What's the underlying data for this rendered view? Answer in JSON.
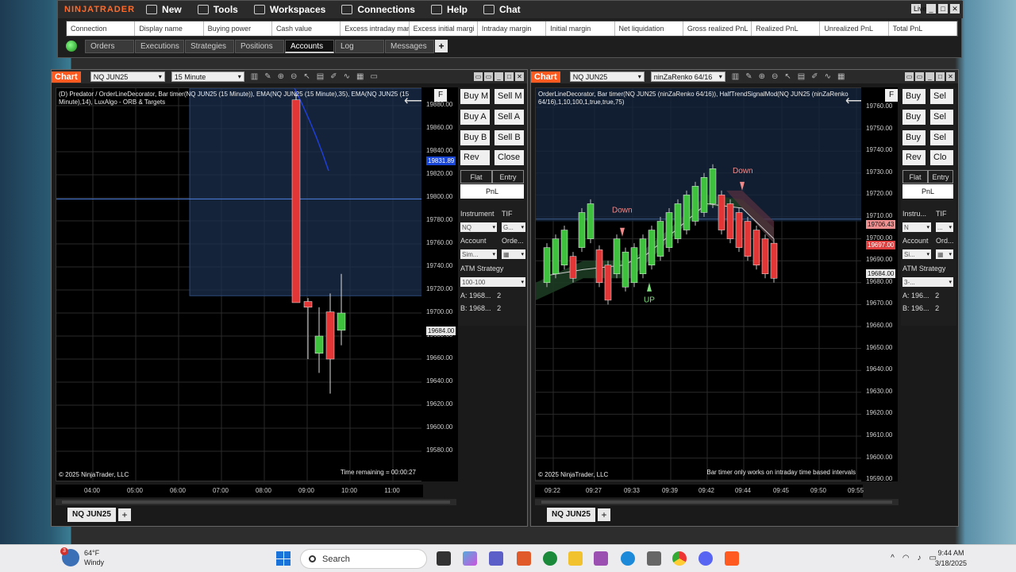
{
  "control_center": {
    "logo": "NINJATRADER",
    "menu": [
      {
        "label": "New",
        "icon": "new-icon"
      },
      {
        "label": "Tools",
        "icon": "tools-icon"
      },
      {
        "label": "Workspaces",
        "icon": "workspaces-icon"
      },
      {
        "label": "Connections",
        "icon": "connections-icon"
      },
      {
        "label": "Help",
        "icon": "help-icon"
      },
      {
        "label": "Chat",
        "icon": "chat-icon"
      }
    ],
    "live_badge": "Live",
    "account_columns": [
      "Connection",
      "Display name",
      "Buying power",
      "Cash value",
      "Excess intraday mar",
      "Excess initial margi",
      "Intraday margin",
      "Initial margin",
      "Net liquidation",
      "Gross realized PnL",
      "Realized PnL",
      "Unrealized PnL",
      "Total PnL"
    ],
    "tabs": [
      "Orders",
      "Executions",
      "Strategies",
      "Positions",
      "Accounts",
      "Log",
      "Messages"
    ],
    "active_tab": "Accounts",
    "colors": {
      "accent": "#ff6a2a",
      "status_green": "#1a8a1a"
    }
  },
  "chart_left": {
    "tag": "Chart",
    "instrument": "NQ JUN25",
    "interval": "15 Minute",
    "description_1": "(D) Predator / OrderLineDecorator, Bar timer(NQ JUN25 (15 Minute)), EMA(NQ JUN25 (15 Minute),35), EMA(NQ JUN25 (15",
    "description_2": "Minute),14), LuxAlgo - ORB & Targets",
    "copyright": "© 2025 NinjaTrader, LLC",
    "time_remaining": "Time remaining = 00:00:27",
    "y_ticks": [
      "19880.00",
      "19860.00",
      "19840.00",
      "19820.00",
      "19800.00",
      "19780.00",
      "19760.00",
      "19740.00",
      "19720.00",
      "19700.00",
      "19680.00",
      "19660.00",
      "19640.00",
      "19620.00",
      "19600.00",
      "19580.00"
    ],
    "price_tags": [
      {
        "label": "19831.89",
        "color": "#1846d8"
      },
      {
        "label": "19684.00",
        "color": "#e8e8e8"
      }
    ],
    "x_ticks": [
      "04:00",
      "05:00",
      "06:00",
      "07:00",
      "08:00",
      "09:00",
      "10:00",
      "11:00"
    ],
    "bottom_tab": "NQ JUN25",
    "chart_trader": {
      "buy_labels": [
        "Buy M",
        "Buy A",
        "Buy B"
      ],
      "sell_labels": [
        "Sell M",
        "Sell A",
        "Sell B"
      ],
      "rev": "Rev",
      "close": "Close",
      "flat": "Flat",
      "entry": "Entry",
      "pnl": "PnL",
      "instrument_label": "Instrument",
      "tif_label": "TIF",
      "instrument_value": "NQ",
      "tif_value": "G...",
      "account_label": "Account",
      "order_label": "Orde...",
      "account_value": "Sim...",
      "atm_label": "ATM Strategy",
      "atm_value": "100-100",
      "a_label": "A:",
      "a_value": "1968...",
      "a_qty": "2",
      "b_label": "B:",
      "b_value": "1968...",
      "b_qty": "2",
      "f_btn": "F"
    }
  },
  "chart_right": {
    "tag": "Chart",
    "instrument": "NQ JUN25",
    "interval": "ninZaRenko 64/16",
    "description_1": "OrderLineDecorator, Bar timer(NQ JUN25 (ninZaRenko 64/16)), HalfTrendSignalMod(NQ JUN25 (ninZaRenko",
    "description_2": "64/16),1,10,100,1,true,true,75)",
    "copyright": "© 2025 NinjaTrader, LLC",
    "bar_timer_note": "Bar timer only works on intraday time based intervals",
    "y_ticks": [
      "19760.00",
      "19750.00",
      "19740.00",
      "19730.00",
      "19720.00",
      "19710.00",
      "19700.00",
      "19690.00",
      "19680.00",
      "19670.00",
      "19660.00",
      "19650.00",
      "19640.00",
      "19630.00",
      "19620.00",
      "19610.00",
      "19600.00",
      "19590.00"
    ],
    "price_tags": [
      {
        "label": "19706.43",
        "color": "#f19090"
      },
      {
        "label": "19697.00",
        "color": "#e04040"
      },
      {
        "label": "19684.00",
        "color": "#e8e8e8"
      }
    ],
    "x_ticks": [
      "09:22",
      "09:27",
      "09:33",
      "09:39",
      "09:42",
      "09:44",
      "09:45",
      "09:50",
      "09:55"
    ],
    "signals": {
      "down_1": "Down",
      "down_2": "Down",
      "up_1": "UP"
    },
    "bottom_tab": "NQ JUN25",
    "chart_trader": {
      "buy_labels": [
        "Buy",
        "Buy",
        "Buy"
      ],
      "sell_labels": [
        "Sel",
        "Sel",
        "Sel"
      ],
      "rev": "Rev",
      "close": "Clo",
      "flat": "Flat",
      "entry": "Entry",
      "pnl": "PnL",
      "instrument_label": "Instru...",
      "tif_label": "TIF",
      "instrument_value": "N",
      "tif_value": "...",
      "account_label": "Account",
      "order_label": "Ord...",
      "account_value": "Si...",
      "atm_label": "ATM Strategy",
      "atm_value": "3-...",
      "a_label": "A:",
      "a_value": "196...",
      "a_qty": "2",
      "b_label": "B:",
      "b_value": "196...",
      "b_qty": "2",
      "f_btn": "F"
    }
  },
  "taskbar": {
    "weather_temp": "64°F",
    "weather_desc": "Windy",
    "weather_badge": "3",
    "search_placeholder": "Search",
    "time": "9:44 AM",
    "date": "3/18/2025"
  }
}
